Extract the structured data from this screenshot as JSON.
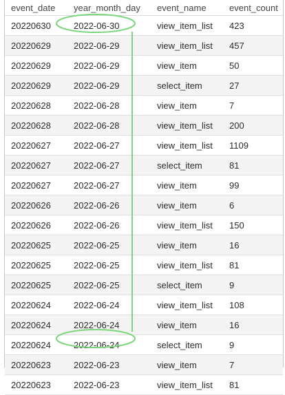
{
  "table": {
    "columns": [
      "event_date",
      "year_month_day",
      "event_name",
      "event_count"
    ],
    "rows": [
      [
        "20220630",
        "2022-06-30",
        "view_item_list",
        "423"
      ],
      [
        "20220629",
        "2022-06-29",
        "view_item_list",
        "457"
      ],
      [
        "20220629",
        "2022-06-29",
        "view_item",
        "50"
      ],
      [
        "20220629",
        "2022-06-29",
        "select_item",
        "27"
      ],
      [
        "20220628",
        "2022-06-28",
        "view_item",
        "7"
      ],
      [
        "20220628",
        "2022-06-28",
        "view_item_list",
        "200"
      ],
      [
        "20220627",
        "2022-06-27",
        "view_item_list",
        "1109"
      ],
      [
        "20220627",
        "2022-06-27",
        "select_item",
        "81"
      ],
      [
        "20220627",
        "2022-06-27",
        "view_item",
        "99"
      ],
      [
        "20220626",
        "2022-06-26",
        "view_item",
        "6"
      ],
      [
        "20220626",
        "2022-06-26",
        "view_item_list",
        "150"
      ],
      [
        "20220625",
        "2022-06-25",
        "view_item",
        "16"
      ],
      [
        "20220625",
        "2022-06-25",
        "view_item_list",
        "81"
      ],
      [
        "20220625",
        "2022-06-25",
        "select_item",
        "9"
      ],
      [
        "20220624",
        "2022-06-24",
        "view_item_list",
        "108"
      ],
      [
        "20220624",
        "2022-06-24",
        "view_item",
        "16"
      ],
      [
        "20220624",
        "2022-06-24",
        "select_item",
        "9"
      ],
      [
        "20220623",
        "2022-06-23",
        "view_item",
        "7"
      ],
      [
        "20220623",
        "2022-06-23",
        "view_item_list",
        "81"
      ]
    ]
  },
  "annotation": {
    "color": "#7ad67a",
    "highlighted_values": [
      "2022-06-30",
      "2022-06-23"
    ]
  }
}
